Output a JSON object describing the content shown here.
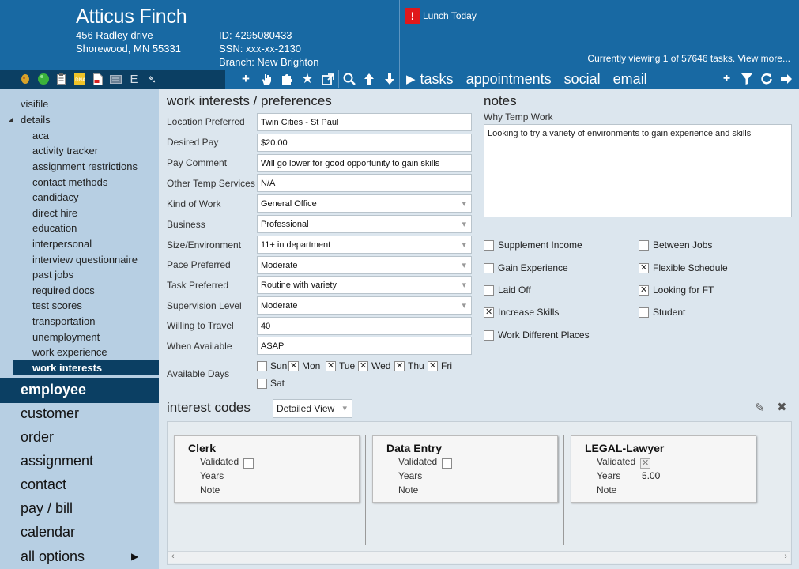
{
  "person": {
    "name": "Atticus Finch",
    "address_line1": "456 Radley drive",
    "address_line2": "Shorewood, MN 55331",
    "id": "ID: 4295080433",
    "ssn": "SSN:  xxx-xx-2130",
    "branch": "Branch:  New Brighton"
  },
  "alert": {
    "badge": "!",
    "text": "Lunch Today"
  },
  "viewing_text": "Currently viewing 1 of 57646 tasks. View more...",
  "tabs": [
    "tasks",
    "appointments",
    "social",
    "email"
  ],
  "sidebar": {
    "visifile": "visifile",
    "details": "details",
    "sub_items": [
      "aca",
      "activity tracker",
      "assignment restrictions",
      "contact methods",
      "candidacy",
      "direct hire",
      "education",
      "interpersonal",
      "interview questionnaire",
      "past jobs",
      "required docs",
      "test scores",
      "transportation",
      "unemployment",
      "work experience"
    ],
    "active_sub": "work interests",
    "active_main": "employee",
    "main_items": [
      "customer",
      "order",
      "assignment",
      "contact",
      "pay / bill",
      "calendar",
      "all options"
    ]
  },
  "work_interests": {
    "title": "work interests / preferences",
    "fields": [
      {
        "label": "Location Preferred",
        "value": "Twin Cities - St Paul",
        "type": "text"
      },
      {
        "label": "Desired Pay",
        "value": "$20.00",
        "type": "text"
      },
      {
        "label": "Pay Comment",
        "value": "Will go lower for good opportunity to gain skills",
        "type": "text"
      },
      {
        "label": "Other Temp Services",
        "value": "N/A",
        "type": "text"
      },
      {
        "label": "Kind of Work",
        "value": "General Office",
        "type": "select"
      },
      {
        "label": "Business",
        "value": "Professional",
        "type": "select"
      },
      {
        "label": "Size/Environment",
        "value": "11+ in department",
        "type": "select"
      },
      {
        "label": "Pace Preferred",
        "value": "Moderate",
        "type": "select"
      },
      {
        "label": "Task Preferred",
        "value": "Routine with variety",
        "type": "select"
      },
      {
        "label": "Supervision Level",
        "value": "Moderate",
        "type": "select"
      },
      {
        "label": "Willing to Travel",
        "value": "40",
        "type": "text"
      },
      {
        "label": "When Available",
        "value": "ASAP",
        "type": "text"
      }
    ],
    "available_days_label": "Available Days",
    "days": [
      {
        "label": "Sun",
        "checked": false
      },
      {
        "label": "Mon",
        "checked": true
      },
      {
        "label": "Tue",
        "checked": true
      },
      {
        "label": "Wed",
        "checked": true
      },
      {
        "label": "Thu",
        "checked": true
      },
      {
        "label": "Fri",
        "checked": true
      },
      {
        "label": "Sat",
        "checked": false
      }
    ]
  },
  "notes": {
    "title": "notes",
    "why_label": "Why Temp Work",
    "text": "Looking to try a variety of environments to gain experience and skills",
    "checks": [
      {
        "label": "Supplement Income",
        "checked": false
      },
      {
        "label": "Between Jobs",
        "checked": false
      },
      {
        "label": "Gain Experience",
        "checked": false
      },
      {
        "label": "Flexible Schedule",
        "checked": true
      },
      {
        "label": "Laid Off",
        "checked": false
      },
      {
        "label": "Looking for FT",
        "checked": true
      },
      {
        "label": "Increase Skills",
        "checked": true
      },
      {
        "label": "Student",
        "checked": false
      },
      {
        "label": "Work Different Places",
        "checked": false
      }
    ]
  },
  "interest_codes": {
    "title": "interest codes",
    "view_select": "Detailed View",
    "cards": [
      {
        "title": "Clerk",
        "validated": false,
        "years": "",
        "note": ""
      },
      {
        "title": "Data Entry",
        "validated": false,
        "years": "",
        "note": ""
      },
      {
        "title": "LEGAL-Lawyer",
        "validated": true,
        "years": "5.00",
        "note": ""
      }
    ],
    "labels": {
      "validated": "Validated",
      "years": "Years",
      "note": "Note"
    }
  },
  "icons": {
    "toolbar_left": [
      "pizza-icon",
      "green-ball-icon",
      "clipboard-icon",
      "dna-icon",
      "pdf-doc-icon",
      "id-card-icon",
      "e-verify-icon",
      "glass-icon"
    ],
    "toolbar_mid": [
      "add-icon",
      "hand-icon",
      "puzzle-icon",
      "star-icon",
      "external-link-icon",
      "search-icon",
      "up-arrow-icon",
      "down-arrow-icon"
    ],
    "toolbar_right": [
      "add-icon",
      "filter-icon",
      "refresh-icon",
      "arrow-right-icon"
    ]
  },
  "colors": {
    "header_bg": "#1869a3",
    "dark_navy": "#0b3f63",
    "sidebar_bg": "#b7cfe3",
    "content_bg": "#dce6ee",
    "alert_red": "#e0181b"
  }
}
